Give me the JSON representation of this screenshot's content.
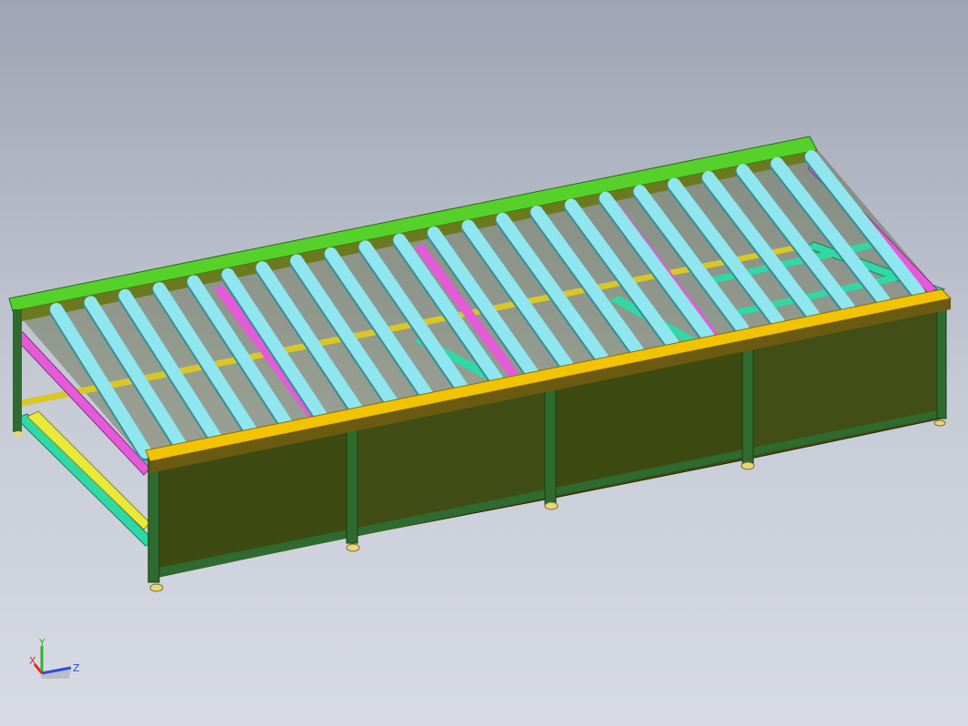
{
  "viewport": {
    "background_top": "#9ea4b3",
    "background_bottom": "#d8dbe4"
  },
  "model": {
    "description_visible": false,
    "colors": {
      "frame_top_rail": "#55d12a",
      "front_rail": "#f2c300",
      "panel": "#3d4a12",
      "post": "#2f6a2f",
      "roller": "#8fe6ef",
      "diagonal_brace": "#e45ad8",
      "cross_member": "#2fd9a6",
      "yellow_bar": "#e9e93a",
      "foot": "#e7d77a"
    },
    "roller_count": 23
  },
  "triad": {
    "x_label": "X",
    "y_label": "Y",
    "z_label": "Z",
    "x_color": "#e32626",
    "y_color": "#2fb52f",
    "z_color": "#2b4fd6"
  }
}
